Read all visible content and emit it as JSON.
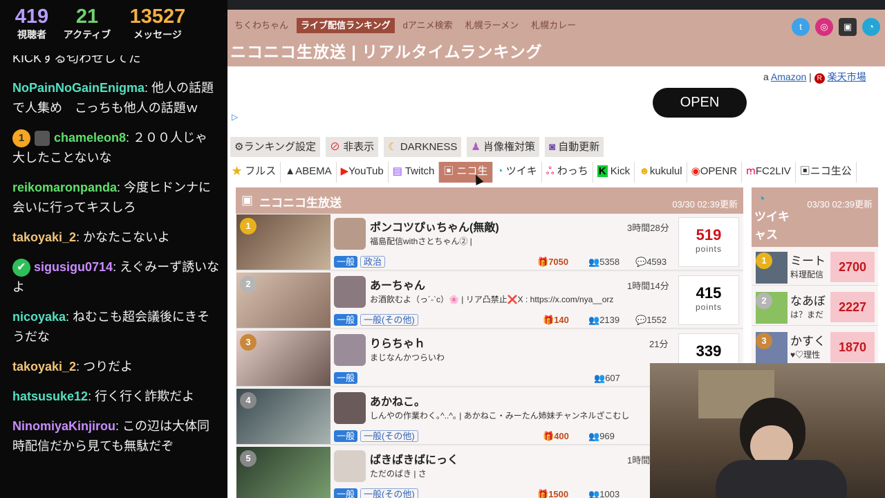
{
  "stats": [
    {
      "value": "419",
      "label": "視聴者",
      "color": "#b79cff"
    },
    {
      "value": "21",
      "label": "アクティブ",
      "color": "#6fd36f"
    },
    {
      "value": "13527",
      "label": "メッセージ",
      "color": "#f5b042"
    }
  ],
  "chat": [
    {
      "user": "",
      "user_color": "#eee",
      "text": "KICKする匂わせしてた"
    },
    {
      "user": "NoPainNoGainEnigma",
      "user_color": "#53e0c2",
      "text": ": 他人の話題で人集め　こっちも他人の話題ｗ"
    },
    {
      "user": "chameleon8",
      "user_color": "#5fe06b",
      "text": ": ２００人じゃ大したことないな",
      "badge": "1"
    },
    {
      "user": "reikomaronpanda",
      "user_color": "#5fe06b",
      "text": ": 今度ヒドンナに会いに行ってキスしろ"
    },
    {
      "user": "takoyaki_2",
      "user_color": "#f2c47a",
      "text": ": かなたこないよ"
    },
    {
      "user": "sigusigu0714",
      "user_color": "#c98cff",
      "text": ": えぐみーず誘いなよ",
      "check": true
    },
    {
      "user": "nicoyaka",
      "user_color": "#53e0c2",
      "text": ": ねむこも超会議後にきそうだな"
    },
    {
      "user": "takoyaki_2",
      "user_color": "#f2c47a",
      "text": ": つりだよ"
    },
    {
      "user": "hatsusuke12",
      "user_color": "#53e0c2",
      "text": ": 行く行く詐欺だよ"
    },
    {
      "user": "NinomiyaKinjirou",
      "user_color": "#c98cff",
      "text": ": この辺は大体同時配信だから見ても無駄だぞ"
    }
  ],
  "nav": [
    "ちくわちゃん",
    "ライブ配信ランキング",
    "dアニメ検索",
    "札幌ラーメン",
    "札幌カレー"
  ],
  "title": "ニコニコ生放送 | リアルタイムランキング",
  "ad": {
    "button": "OPEN"
  },
  "shop": {
    "amazon": "Amazon",
    "sep": "|",
    "rakuten": "楽天市場"
  },
  "tools": [
    "ランキング設定",
    "非表示",
    "DARKNESS",
    "肖像権対策",
    "自動更新"
  ],
  "tabs": [
    "フルス",
    "ABEMA",
    "YouTub",
    "Twitch",
    "ニコ生",
    "ツイキ",
    "わっち",
    "Kick",
    "kukulul",
    "OPENR",
    "FC2LIV",
    "ニコ生公"
  ],
  "main": {
    "header": "ニコニコ生放送",
    "date": "03/30 02:39更新",
    "rows": [
      {
        "rank": "1",
        "name": "ポンコツぴぃちゃん(無敵)",
        "desc": "福島配信withさとちゃん② |",
        "time": "3時間28分",
        "cat": "一般",
        "sub": "政治",
        "gift": "7050",
        "viewers": "5358",
        "comments": "4593",
        "points": "519",
        "points_color": "#d0121b"
      },
      {
        "rank": "2",
        "name": "あーちゃん",
        "desc": "お酒飲むよ（っ´-`c）🌸 | リア凸禁止❌X : https://x.com/nya__orz",
        "time": "1時間14分",
        "cat": "一般",
        "sub": "一般(その他)",
        "gift": "140",
        "viewers": "2139",
        "comments": "1552",
        "points": "415",
        "points_color": "#222"
      },
      {
        "rank": "3",
        "name": "りらちゃｈ",
        "desc": "まじなんかつらいわ",
        "time": "21分",
        "cat": "一般",
        "sub": "",
        "gift": "",
        "viewers": "607",
        "comments": "",
        "points": "339",
        "points_color": "#222"
      },
      {
        "rank": "4",
        "name": "あかねこ。",
        "desc": "しんやの作業わく｡^..^｡ | あかねこ・みーたん姉妹チャンネルざこむし",
        "time": "",
        "cat": "一般",
        "sub": "一般(その他)",
        "gift": "400",
        "viewers": "969",
        "comments": "",
        "points": "",
        "points_color": "#222"
      },
      {
        "rank": "5",
        "name": "ばきばきばにっく",
        "desc": "ただのばき | さ",
        "time": "1時間",
        "cat": "一般",
        "sub": "一般(その他)",
        "gift": "1500",
        "viewers": "1003",
        "comments": "",
        "points": "",
        "points_color": "#222"
      }
    ],
    "points_label": "points"
  },
  "side": {
    "header": "ツイキャス",
    "date": "03/30 02:39更新",
    "rows": [
      {
        "rank": "1",
        "name": "ミート",
        "desc": "料理配信",
        "points": "2700"
      },
      {
        "rank": "2",
        "name": "なあぼ",
        "desc": "は？まだ",
        "points": "2227"
      },
      {
        "rank": "3",
        "name": "かすく",
        "desc": "♥♡理性",
        "points": "1870"
      }
    ]
  }
}
